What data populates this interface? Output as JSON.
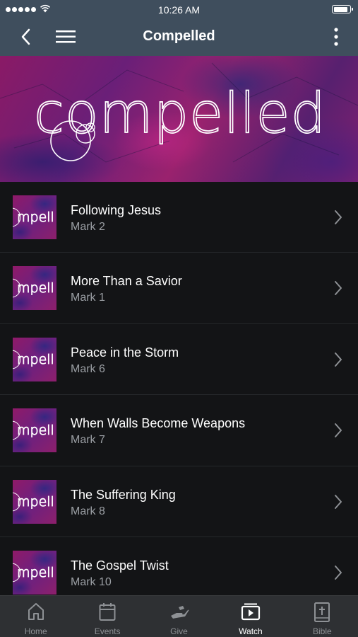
{
  "status_bar": {
    "time": "10:26 AM",
    "signal_icon": "cellular-signal-icon",
    "wifi_icon": "wifi-icon",
    "battery_icon": "battery-icon",
    "battery_level": 0.9
  },
  "nav": {
    "title": "Compelled",
    "back_icon": "back-chevron-icon",
    "menu_icon": "hamburger-menu-icon",
    "more_icon": "more-vertical-icon"
  },
  "banner": {
    "logo_text": "compelled"
  },
  "thumbnail_text": "mpell",
  "items": [
    {
      "title": "Following Jesus",
      "subtitle": "Mark 2"
    },
    {
      "title": "More Than a Savior",
      "subtitle": "Mark 1"
    },
    {
      "title": "Peace in the Storm",
      "subtitle": "Mark 6"
    },
    {
      "title": "When Walls Become Weapons",
      "subtitle": "Mark 7"
    },
    {
      "title": "The Suffering King",
      "subtitle": "Mark 8"
    },
    {
      "title": "The Gospel Twist",
      "subtitle": "Mark 10"
    }
  ],
  "tabs": [
    {
      "label": "Home",
      "icon": "home-icon",
      "active": false
    },
    {
      "label": "Events",
      "icon": "calendar-icon",
      "active": false
    },
    {
      "label": "Give",
      "icon": "give-hand-icon",
      "active": false
    },
    {
      "label": "Watch",
      "icon": "play-video-icon",
      "active": true
    },
    {
      "label": "Bible",
      "icon": "bible-icon",
      "active": false
    }
  ],
  "colors": {
    "nav_background": "#3f4e5d",
    "list_background": "#131416",
    "banner_magenta": "#8a1a66",
    "tab_active": "#ffffff",
    "tab_inactive": "#8e9195"
  }
}
